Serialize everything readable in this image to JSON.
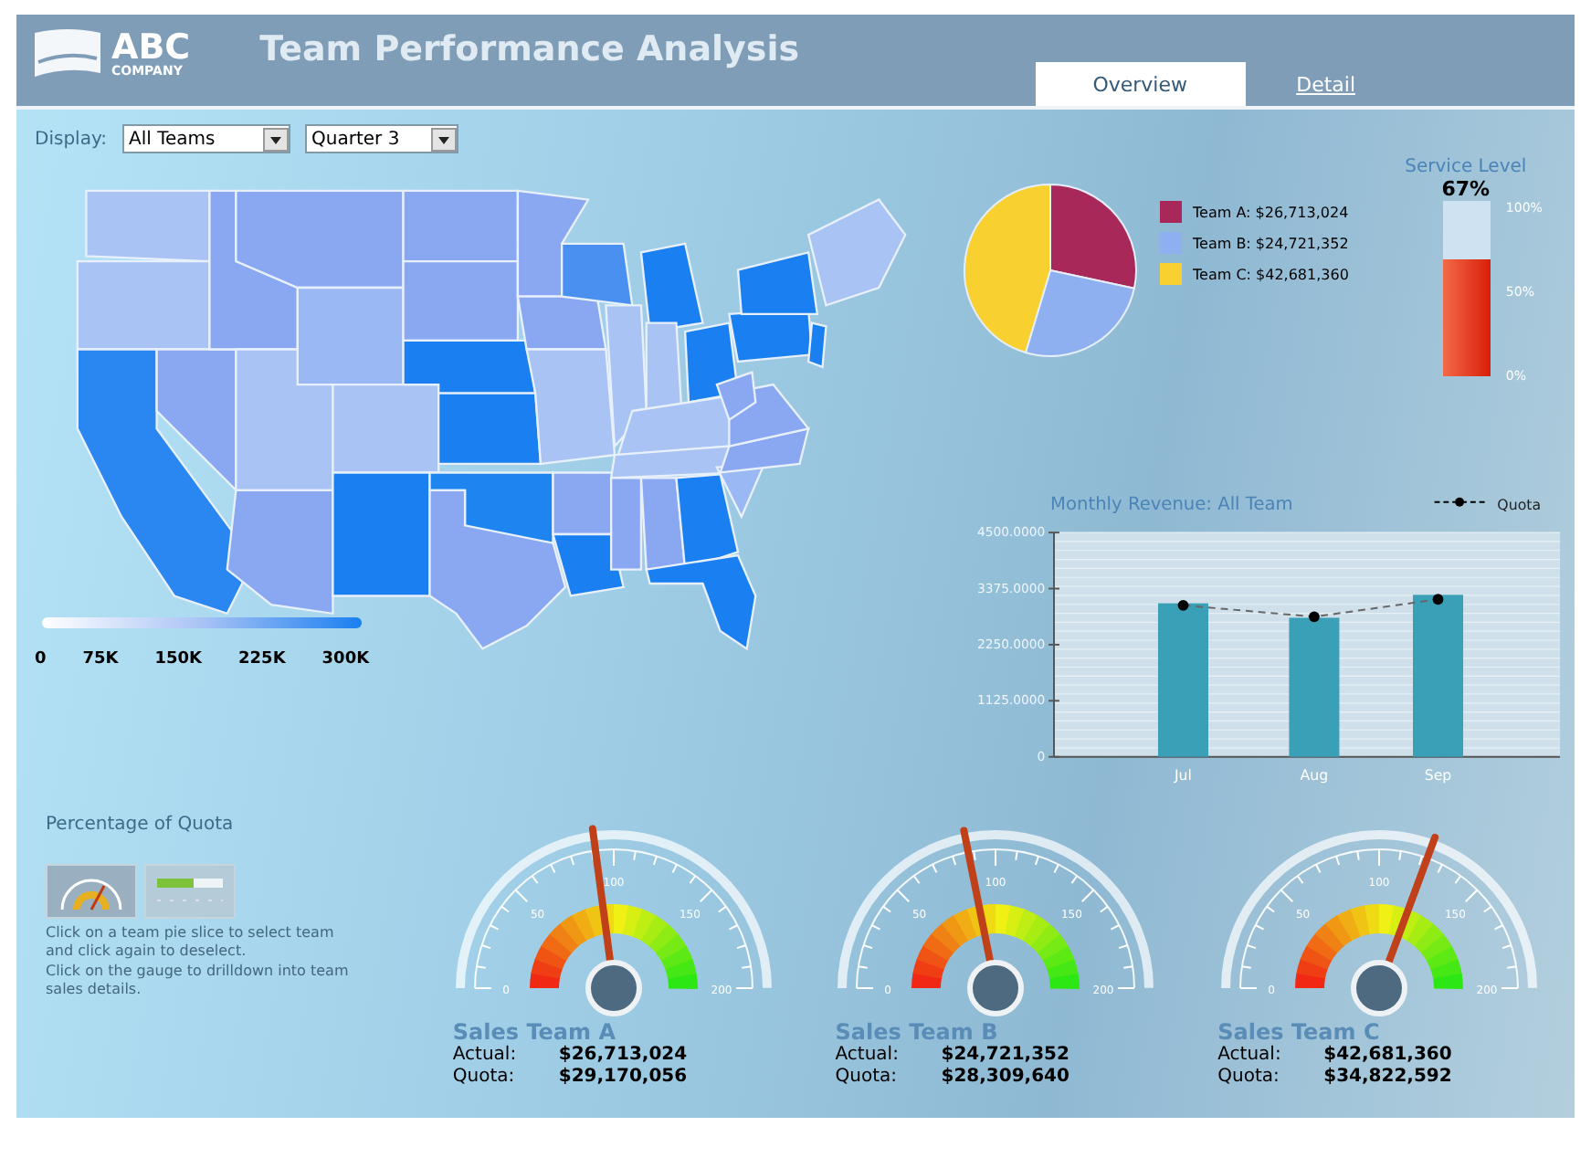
{
  "header": {
    "logo": {
      "line_1": "ABC",
      "line_2": "COMPANY"
    },
    "title": "Team Performance Analysis"
  },
  "tabs": [
    {
      "label": "Overview",
      "selected": true
    },
    {
      "label": "Detail",
      "selected": false
    }
  ],
  "filters": {
    "label": "Display:",
    "dropdowns": [
      {
        "value": "All Teams"
      },
      {
        "value": "Quarter 3"
      }
    ]
  },
  "map": {
    "scale_labels": [
      "0",
      "75K",
      "150K",
      "225K",
      "300K"
    ]
  },
  "pie": {
    "chart_data": {
      "type": "pie",
      "categories": [
        "Team A: $26,713,024",
        "Team B: $24,721,352",
        "Team C: $42,681,360"
      ],
      "values": [
        26713024,
        24721352,
        42681360
      ]
    },
    "legend": [
      {
        "color": "#a8285a"
      },
      {
        "color": "#8fb0f0"
      },
      {
        "color": "#f8d030"
      }
    ]
  },
  "service_level": {
    "title": "Service Level",
    "reading": "67%",
    "level": 0.67,
    "ticks": [
      "100%",
      "50%",
      "0%"
    ]
  },
  "revenue_chart": {
    "chart_data": {
      "type": "bar",
      "title": "Monthly Revenue: All Team",
      "categories": [
        "Jul",
        "Aug",
        "Sep"
      ],
      "ylim": [
        0,
        4500
      ],
      "yticks": [
        {
          "value": 0,
          "label": "0"
        },
        {
          "value": 1125,
          "label": "1125.0000"
        },
        {
          "value": 2250,
          "label": "2250.0000"
        },
        {
          "value": 3375,
          "label": "3375.0000"
        },
        {
          "value": 4500,
          "label": "4500.0000"
        }
      ],
      "series": [
        {
          "type": "bar",
          "color": "#3aa0b8",
          "values": [
            3080,
            2790,
            3250
          ]
        },
        {
          "type": "line",
          "line_style": "dashed",
          "marker": "circle",
          "name": "Quota",
          "color": "#000000",
          "values": [
            3040,
            2810,
            3160
          ]
        }
      ]
    }
  },
  "quota_panel": {
    "title": "Percentage of Quota",
    "views": [
      {
        "kind": "gauge"
      },
      {
        "kind": "bar"
      }
    ],
    "help": [
      "Click on a team pie slice to select team and click again to deselect.",
      "Click on the gauge to drilldown into team sales details."
    ]
  },
  "gauges": [
    {
      "ticks": [
        "0",
        "50",
        "100",
        "150",
        "200"
      ],
      "level": 0.458,
      "title": "Sales Team A",
      "actual_label": "Actual:",
      "actual": "$26,713,024",
      "quota_label": "Quota:",
      "quota": "$29,170,056"
    },
    {
      "ticks": [
        "0",
        "50",
        "100",
        "150",
        "200"
      ],
      "level": 0.437,
      "title": "Sales Team B",
      "actual_label": "Actual:",
      "actual": "$24,721,352",
      "quota_label": "Quota:",
      "quota": "$28,309,640"
    },
    {
      "ticks": [
        "0",
        "50",
        "100",
        "150",
        "200"
      ],
      "level": 0.613,
      "title": "Sales Team C",
      "actual_label": "Actual:",
      "actual": "$42,681,360",
      "quota_label": "Quota:",
      "quota": "$34,822,592"
    }
  ]
}
